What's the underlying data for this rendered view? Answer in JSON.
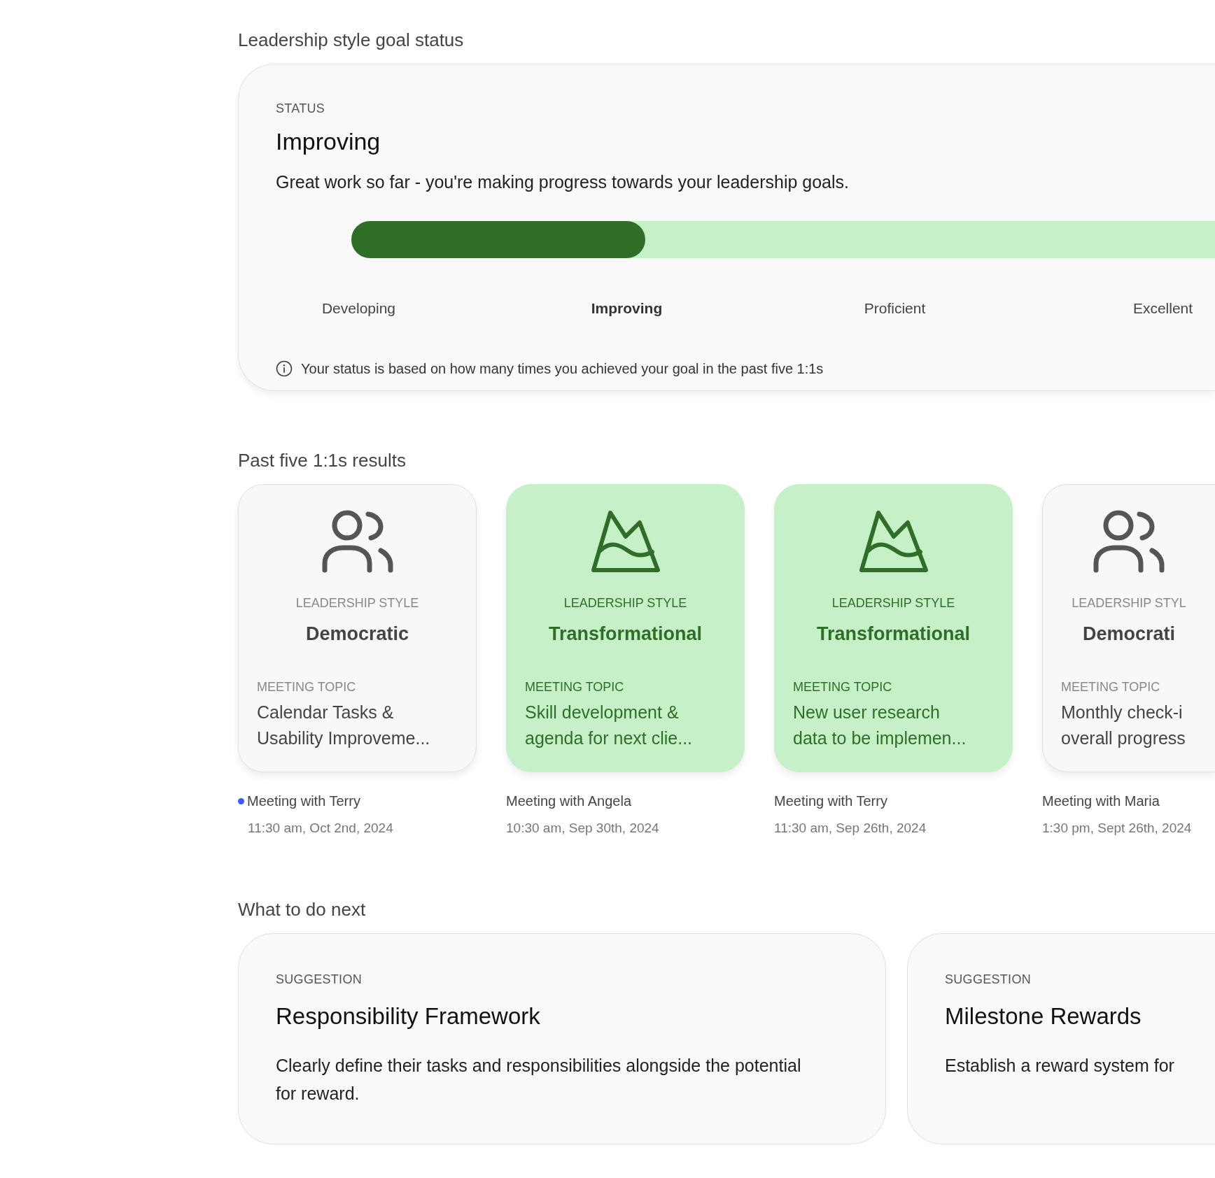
{
  "goal_status": {
    "heading": "Leadership style goal status",
    "label": "STATUS",
    "title": "Improving",
    "description": "Great work so far - you're making progress towards your leadership goals.",
    "level": 0.34,
    "scale": [
      {
        "label": "Developing",
        "selected": false
      },
      {
        "label": "Improving",
        "selected": true
      },
      {
        "label": "Proficient",
        "selected": false
      },
      {
        "label": "Excellent",
        "selected": false
      }
    ],
    "note": "Your status is based on how many times you achieved your goal in the past five 1:1s"
  },
  "results": {
    "heading": "Past five 1:1s results",
    "meetings": [
      {
        "achieved": false,
        "style_label": "LEADERSHIP STYLE",
        "style": "Democratic",
        "topic_label": "MEETING TOPIC",
        "topic": "Calendar Tasks &\nUsability Improveme...",
        "title": "Meeting with Terry",
        "time": "11:30 am, Oct 2nd, 2024",
        "unread": true
      },
      {
        "achieved": true,
        "style_label": "LEADERSHIP STYLE",
        "style": "Transformational",
        "topic_label": "MEETING TOPIC",
        "topic": "Skill development &\nagenda for next clie...",
        "title": "Meeting with Angela",
        "time": "10:30 am, Sep 30th, 2024",
        "unread": false
      },
      {
        "achieved": true,
        "style_label": "LEADERSHIP STYLE",
        "style": "Transformational",
        "topic_label": "MEETING TOPIC",
        "topic": "New user research\ndata to be implemen...",
        "title": "Meeting with Terry",
        "time": "11:30 am, Sep 26th, 2024",
        "unread": false
      },
      {
        "achieved": false,
        "style_label": "LEADERSHIP STYL",
        "style": "Democrati",
        "topic_label": "MEETING TOPIC",
        "topic": "Monthly check-i\noverall progress",
        "title": "Meeting with Maria",
        "time": "1:30 pm, Sept 26th, 2024",
        "unread": false
      }
    ]
  },
  "next": {
    "heading": "What to do next",
    "suggestions": [
      {
        "label": "SUGGESTION",
        "title": "Responsibility Framework",
        "text": "Clearly define their tasks and responsibilities alongside the potential for reward."
      },
      {
        "label": "SUGGESTION",
        "title": "Milestone Rewards",
        "text": "Establish a reward system for"
      }
    ]
  }
}
